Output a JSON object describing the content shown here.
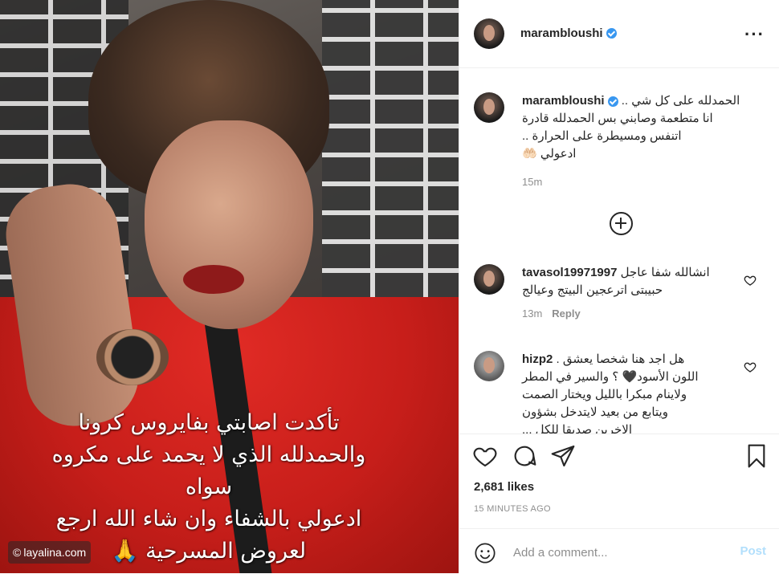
{
  "photo": {
    "overlay_lines": [
      "تأكدت اصابتي بفايروس كرونا",
      "والحمدلله الذي لا يحمد على مكروه",
      "سواه",
      "ادعولي بالشفاء وان شاء الله ارجع",
      "لعروض المسرحية 🙏"
    ],
    "watermark": "layalina.com",
    "watermark_icon": "copyright-icon"
  },
  "header": {
    "username": "marambloushi",
    "verified": true,
    "more_icon": "more-options-icon"
  },
  "caption": {
    "username": "marambloushi",
    "text_lines": [
      "الحمدلله على كل شي ..",
      "انا متطعمة وصابني بس الحمدلله قادرة",
      "اتنفس ومسيطرة على الحرارة ..",
      "ادعولي 🤲🏻"
    ],
    "time": "15m"
  },
  "load_more_icon": "plus-circle-icon",
  "comments": [
    {
      "username": "tavasol19971997",
      "text_first": "انشالله شفا عاجل",
      "text_rest": "حبيبتى اترعجين البيتج وعيالج",
      "time": "13m",
      "reply": "Reply"
    },
    {
      "username": "hizp2",
      "text_first": "هل اجد هنا شخصا يعشق .",
      "text_rest_lines": [
        "اللون الأسود🖤 ؟ والسير في المطر",
        "ولاينام مبكرا بالليل ويختار الصمت",
        "ويتابع من بعيد لايتدخل بشؤون",
        "الاخرين صديقا للكل ..."
      ]
    }
  ],
  "actions": {
    "like_icon": "heart-icon",
    "comment_icon": "comment-icon",
    "share_icon": "paper-plane-icon",
    "save_icon": "bookmark-icon"
  },
  "likes": "2,681 likes",
  "time_ago": "15 MINUTES AGO",
  "add_comment": {
    "placeholder": "Add a comment...",
    "post_label": "Post",
    "emoji_icon": "emoji-icon"
  }
}
